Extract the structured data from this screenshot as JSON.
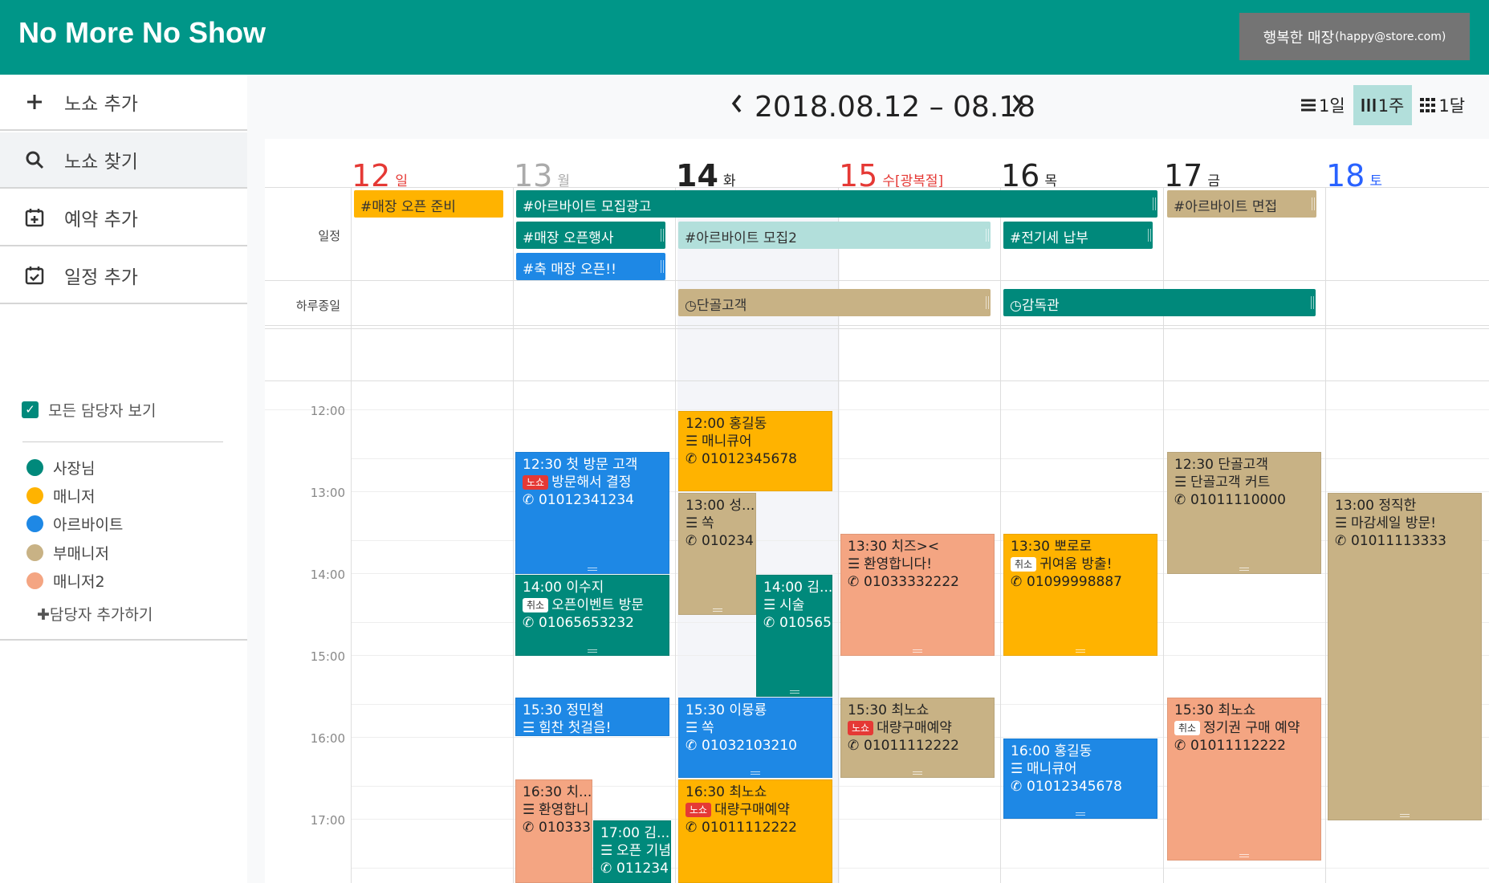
{
  "app": {
    "title": "No More No Show"
  },
  "user": {
    "name": "행복한 매장",
    "email": "(happy@store.com)"
  },
  "sidebar": {
    "menu": [
      {
        "label": "노쇼 추가",
        "icon": "plus-icon"
      },
      {
        "label": "노쇼 찾기",
        "icon": "search-icon"
      },
      {
        "label": "예약 추가",
        "icon": "calendar-plus-icon"
      },
      {
        "label": "일정 추가",
        "icon": "calendar-check-icon"
      }
    ],
    "show_all": "모든 담당자 보기",
    "staff": [
      {
        "name": "사장님",
        "color": "#00897b"
      },
      {
        "name": "매니저",
        "color": "#ffb300"
      },
      {
        "name": "아르바이트",
        "color": "#1e88e5"
      },
      {
        "name": "부매니저",
        "color": "#c8b285"
      },
      {
        "name": "매니저2",
        "color": "#f4a582"
      }
    ],
    "add_staff": "담당자 추가하기"
  },
  "toolbar": {
    "range": "2018.08.12 – 08.18",
    "views": [
      {
        "label": "1일",
        "icon": "list-icon"
      },
      {
        "label": "1주",
        "icon": "week-columns-icon"
      },
      {
        "label": "1달",
        "icon": "month-grid-icon"
      }
    ]
  },
  "days": [
    {
      "num": "12",
      "name": "일",
      "color": "#e53935"
    },
    {
      "num": "13",
      "name": "월",
      "color": "#aaaaaa"
    },
    {
      "num": "14",
      "name": "화",
      "color": "#222222"
    },
    {
      "num": "15",
      "name": "수[광복절]",
      "color": "#e53935"
    },
    {
      "num": "16",
      "name": "목",
      "color": "#222222"
    },
    {
      "num": "17",
      "name": "금",
      "color": "#222222"
    },
    {
      "num": "18",
      "name": "토",
      "color": "#2962ff"
    }
  ],
  "rows": {
    "schedule": "일정",
    "allday": "하루종일"
  },
  "times": [
    "12:00",
    "13:00",
    "14:00",
    "15:00",
    "16:00",
    "17:00"
  ],
  "schedule_bars": [
    {
      "text": "#매장 오픈 준비",
      "color": "#ffb300",
      "dark": true
    },
    {
      "text": "#아르바이트 모집광고",
      "color": "#00897b",
      "dark": false
    },
    {
      "text": "#아르바이트 면접",
      "color": "#c8b285",
      "dark": true
    },
    {
      "text": "#매장 오픈행사",
      "color": "#00897b",
      "dark": false
    },
    {
      "text": "#아르바이트 모집2",
      "color": "#b2dfdb",
      "dark": true
    },
    {
      "text": "#전기세 납부",
      "color": "#00897b",
      "dark": false
    },
    {
      "text": "#축 매장 오픈!!",
      "color": "#1e88e5",
      "dark": false
    }
  ],
  "allday_bars": [
    {
      "text": "단골고객",
      "color": "#c8b285",
      "dark": true
    },
    {
      "text": "감독관",
      "color": "#00897b",
      "dark": false
    }
  ],
  "events": [
    {
      "time": "12:00",
      "title": "홍길동",
      "memo": "매니큐어",
      "phone": "01012345678",
      "color": "#ffb300",
      "dark": true
    },
    {
      "time": "12:30",
      "title": "첫 방문 고객",
      "tag": "노쇼",
      "memo": "방문해서 결정",
      "phone": "01012341234",
      "color": "#1e88e5",
      "dark": false
    },
    {
      "time": "12:30",
      "title": "단골고객",
      "memo": "단골고객 커트",
      "phone": "01011110000",
      "color": "#c8b285",
      "dark": true
    },
    {
      "time": "13:00",
      "title": "성...",
      "memo": "쏙",
      "phone": "010234",
      "color": "#c8b285",
      "dark": true
    },
    {
      "time": "13:00",
      "title": "정직한",
      "memo": "마감세일 방문!",
      "phone": "01011113333",
      "color": "#c8b285",
      "dark": true
    },
    {
      "time": "13:30",
      "title": "치즈><",
      "memo": "환영합니다!",
      "phone": "01033332222",
      "color": "#f4a582",
      "dark": true
    },
    {
      "time": "13:30",
      "title": "뽀로로",
      "tag": "취소",
      "memo": "귀여움 방출!",
      "phone": "01099998887",
      "color": "#ffb300",
      "dark": true
    },
    {
      "time": "14:00",
      "title": "이수지",
      "tag": "취소",
      "memo": "오픈이벤트 방문",
      "phone": "01065653232",
      "color": "#00897b",
      "dark": false
    },
    {
      "time": "14:00",
      "title": "김...",
      "memo": "시술",
      "phone": "010565",
      "color": "#00897b",
      "dark": false
    },
    {
      "time": "15:30",
      "title": "정민철",
      "memo": "힘찬 첫걸음!",
      "color": "#1e88e5",
      "dark": false
    },
    {
      "time": "15:30",
      "title": "이몽룡",
      "memo": "쏙",
      "phone": "01032103210",
      "color": "#1e88e5",
      "dark": false
    },
    {
      "time": "15:30",
      "title": "최노쇼",
      "tag": "노쇼",
      "memo": "대량구매예약",
      "phone": "01011112222",
      "color": "#c8b285",
      "dark": true
    },
    {
      "time": "15:30",
      "title": "최노쇼",
      "tag": "취소",
      "memo": "정기권 구매 예약",
      "phone": "01011112222",
      "color": "#f4a582",
      "dark": true
    },
    {
      "time": "16:00",
      "title": "홍길동",
      "memo": "매니큐어",
      "phone": "01012345678",
      "color": "#1e88e5",
      "dark": false
    },
    {
      "time": "16:30",
      "title": "치...",
      "memo": "환영합니",
      "phone": "010333",
      "color": "#f4a582",
      "dark": true
    },
    {
      "time": "16:30",
      "title": "최노쇼",
      "tag": "노쇼",
      "memo": "대량구매예약",
      "phone": "01011112222",
      "color": "#ffb300",
      "dark": true
    },
    {
      "time": "17:00",
      "title": "김...",
      "memo": "오픈 기념",
      "phone": "011234",
      "color": "#00897b",
      "dark": false
    }
  ]
}
